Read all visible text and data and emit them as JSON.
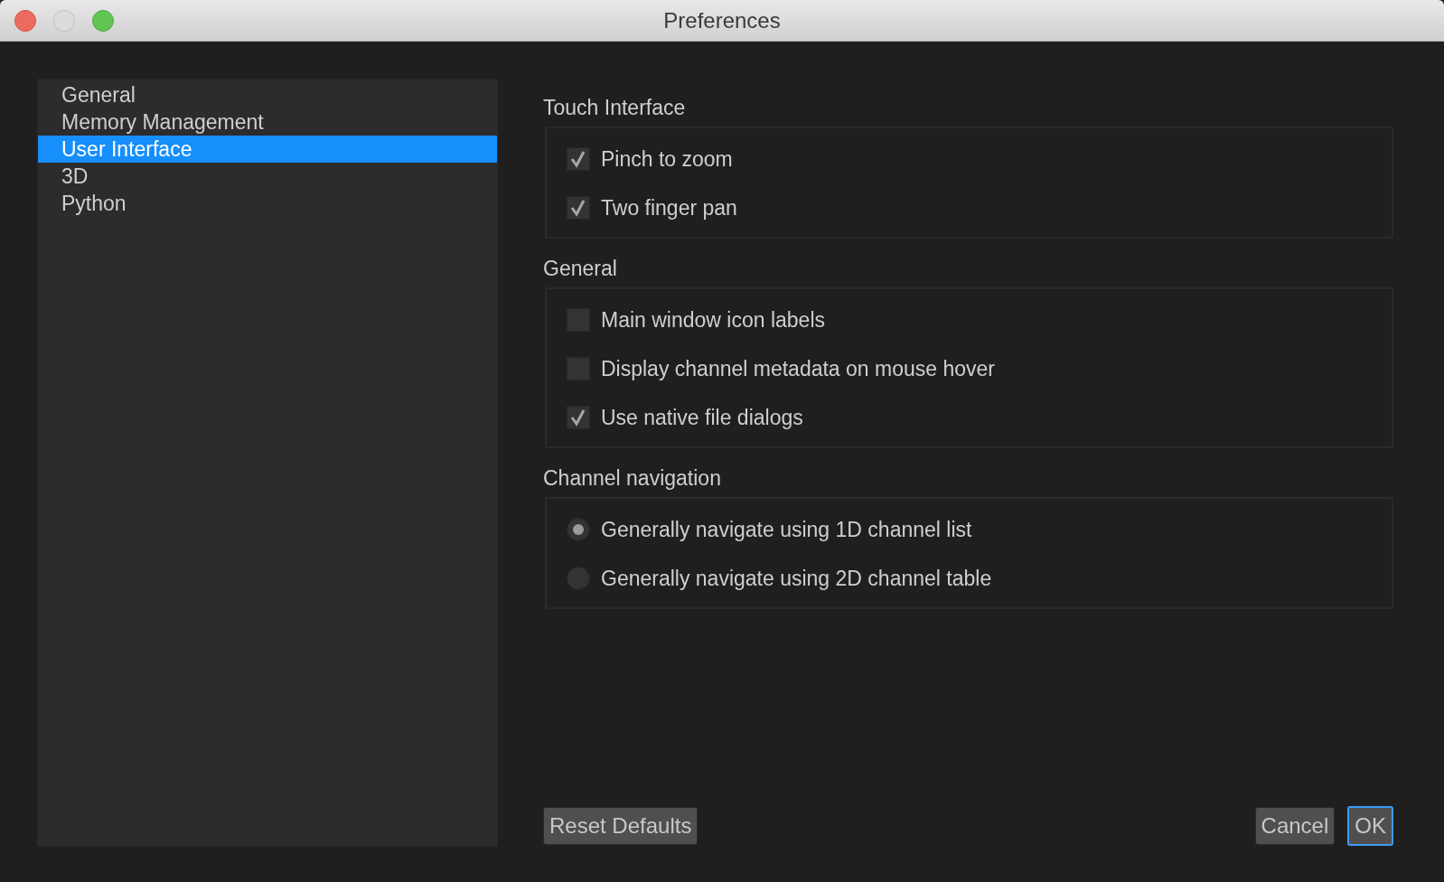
{
  "window": {
    "title": "Preferences"
  },
  "sidebar": {
    "items": [
      {
        "label": "General",
        "selected": false
      },
      {
        "label": "Memory Management",
        "selected": false
      },
      {
        "label": "User Interface",
        "selected": true
      },
      {
        "label": "3D",
        "selected": false
      },
      {
        "label": "Python",
        "selected": false
      }
    ]
  },
  "groups": [
    {
      "title": "Touch Interface",
      "options": [
        {
          "kind": "checkbox",
          "label": "Pinch to zoom",
          "checked": true
        },
        {
          "kind": "checkbox",
          "label": "Two finger pan",
          "checked": true
        }
      ]
    },
    {
      "title": "General",
      "options": [
        {
          "kind": "checkbox",
          "label": "Main window icon labels",
          "checked": false
        },
        {
          "kind": "checkbox",
          "label": "Display channel metadata on mouse hover",
          "checked": false
        },
        {
          "kind": "checkbox",
          "label": "Use native file dialogs",
          "checked": true
        }
      ]
    },
    {
      "title": "Channel navigation",
      "options": [
        {
          "kind": "radio",
          "label": "Generally navigate using 1D channel list",
          "selected": true
        },
        {
          "kind": "radio",
          "label": "Generally navigate using 2D channel table",
          "selected": false
        }
      ]
    }
  ],
  "buttons": {
    "reset": "Reset Defaults",
    "cancel": "Cancel",
    "ok": "OK"
  }
}
